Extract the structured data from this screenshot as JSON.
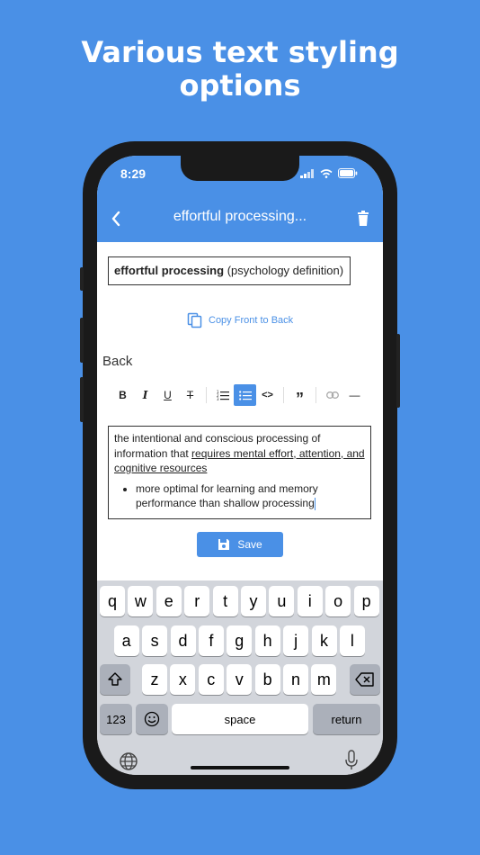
{
  "headline": {
    "line1": "Various text styling",
    "line2": "options"
  },
  "status": {
    "time": "8:29"
  },
  "nav": {
    "title": "effortful processing..."
  },
  "front": {
    "bold": "effortful processing",
    "rest": " (psychology definition)"
  },
  "copy_label": "Copy Front to Back",
  "back_label": "Back",
  "toolbar": [
    {
      "name": "bold-button",
      "glyph": "B",
      "icon": "bold-icon",
      "active": false
    },
    {
      "name": "italic-button",
      "glyph": "I",
      "icon": "italic-icon",
      "active": false
    },
    {
      "name": "underline-button",
      "glyph": "U",
      "icon": "underline-icon",
      "active": false
    },
    {
      "name": "strikethrough-button",
      "glyph": "T",
      "icon": "strikethrough-icon",
      "active": false
    },
    {
      "name": "ordered-list-button",
      "glyph": "1.",
      "icon": "ordered-list-icon",
      "active": false
    },
    {
      "name": "bullet-list-button",
      "glyph": "•",
      "icon": "bullet-list-icon",
      "active": true
    },
    {
      "name": "code-button",
      "glyph": "<>",
      "icon": "code-icon",
      "active": false
    },
    {
      "name": "quote-button",
      "glyph": "”",
      "icon": "quote-icon",
      "active": false
    },
    {
      "name": "link-button",
      "glyph": "∞",
      "icon": "link-icon",
      "active": false
    },
    {
      "name": "horizontal-rule-button",
      "glyph": "—",
      "icon": "horizontal-rule-icon",
      "active": false
    }
  ],
  "editor": {
    "text_plain": "the intentional and conscious processing of information that ",
    "text_underlined": "requires mental effort, attention, and cognitive resources",
    "bullet": "more optimal for learning and memory performance than shallow processing"
  },
  "save_label": "Save",
  "keyboard": {
    "row1": [
      "q",
      "w",
      "e",
      "r",
      "t",
      "y",
      "u",
      "i",
      "o",
      "p"
    ],
    "row2": [
      "a",
      "s",
      "d",
      "f",
      "g",
      "h",
      "j",
      "k",
      "l"
    ],
    "row3": [
      "z",
      "x",
      "c",
      "v",
      "b",
      "n",
      "m"
    ],
    "numbers_key": "123",
    "space_key": "space",
    "return_key": "return"
  },
  "colors": {
    "accent": "#4a90e6",
    "keyboard_bg": "#d2d5db"
  }
}
